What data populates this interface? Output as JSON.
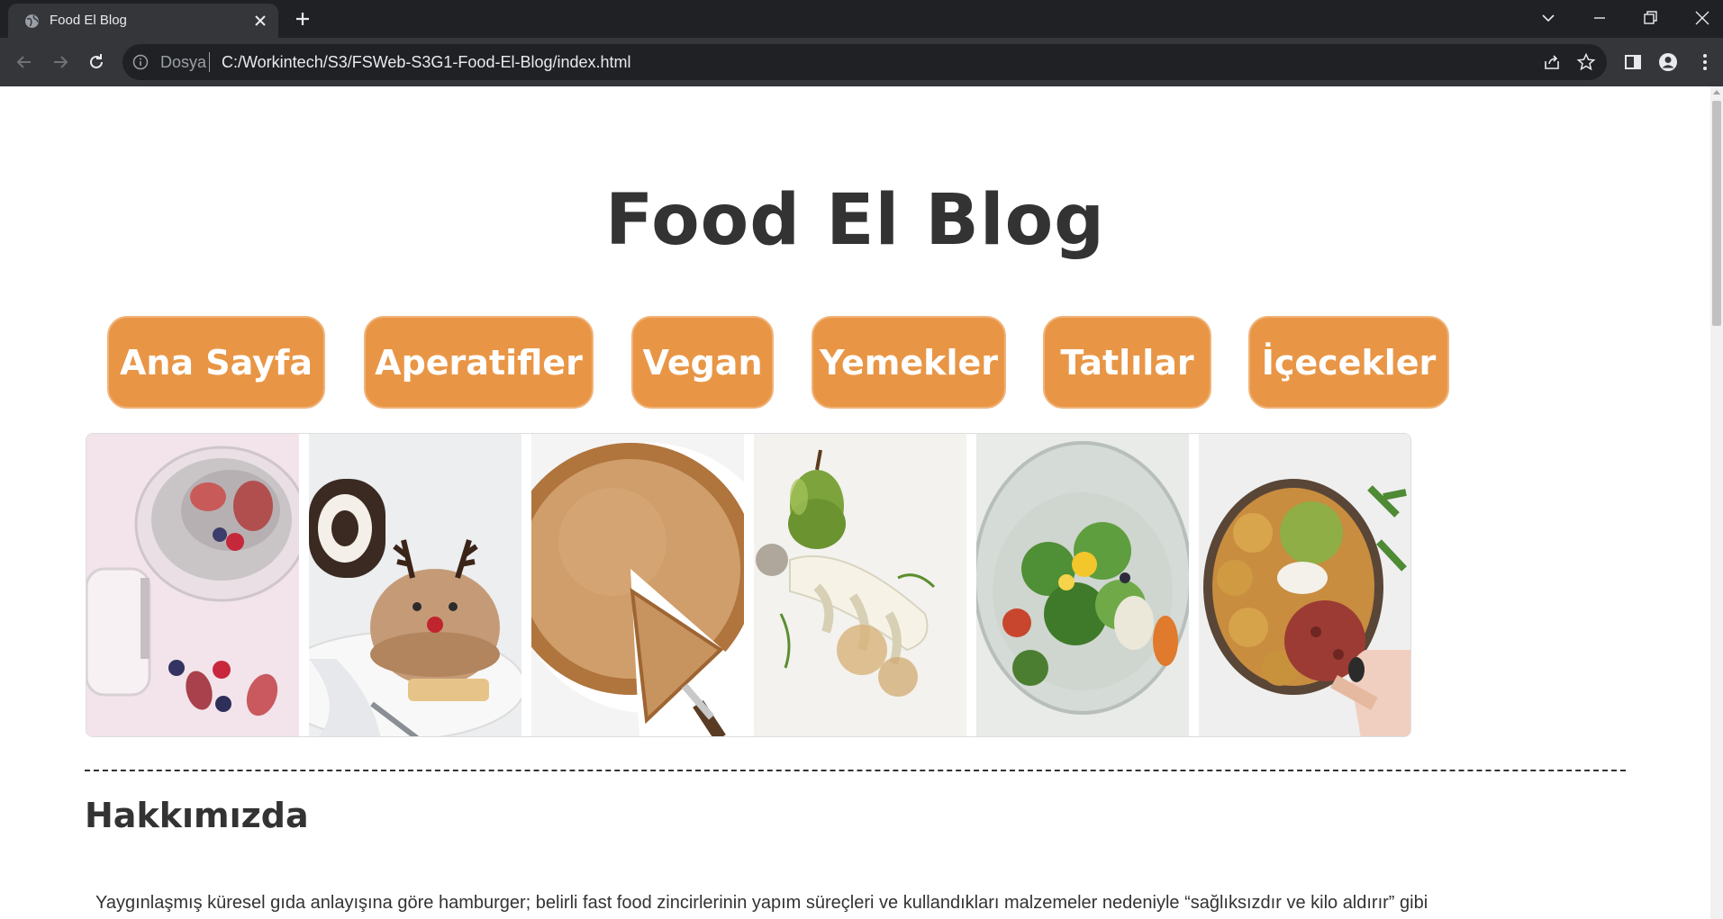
{
  "browser": {
    "tab_title": "Food El Blog",
    "omnibox_scheme": "Dosya",
    "url": "C:/Workintech/S3/FSWeb-S3G1-Food-El-Blog/index.html"
  },
  "page": {
    "title": "Food El Blog",
    "nav": [
      "Ana Sayfa",
      "Aperatifler",
      "Vegan",
      "Yemekler",
      "Tatlılar",
      "İçecekler"
    ],
    "gallery": [
      "chia-pudding-figs",
      "reindeer-cake-dessert",
      "pie-slice",
      "pear-plated-dish",
      "salad-in-glass",
      "veggie-bowl-hand"
    ],
    "section_title": "Hakkımızda",
    "paragraph": "Yaygınlaşmış küresel gıda anlayışına göre hamburger; belirli fast food zincirlerinin yapım süreçleri ve kullandıkları malzemeler nedeniyle “sağlıksızdır ve kilo aldırır” gibi"
  },
  "colors": {
    "nav_button": "#e89646",
    "text": "#333333",
    "chrome_dark": "#202124",
    "chrome_toolbar": "#35363a"
  }
}
